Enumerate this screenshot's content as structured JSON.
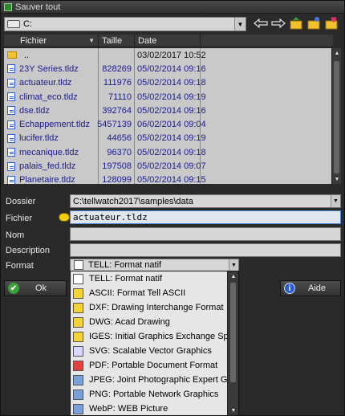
{
  "window": {
    "title": "Sauver tout"
  },
  "drive": {
    "label": "C:"
  },
  "list": {
    "headers": {
      "name": "Fichier",
      "size": "Taille",
      "date": "Date"
    },
    "rows": [
      {
        "name": "..",
        "size": "",
        "date": "03/02/2017 10:52",
        "type": "folder"
      },
      {
        "name": "23Y Series.tldz",
        "size": "828269",
        "date": "05/02/2014 09:16",
        "type": "file"
      },
      {
        "name": "actuateur.tldz",
        "size": "111976",
        "date": "05/02/2014 09:18",
        "type": "file"
      },
      {
        "name": "climat_eco.tldz",
        "size": "71110",
        "date": "05/02/2014 09:19",
        "type": "file"
      },
      {
        "name": "dse.tldz",
        "size": "392764",
        "date": "05/02/2014 09:16",
        "type": "file"
      },
      {
        "name": "Echappement.tldz",
        "size": "5457139",
        "date": "06/02/2014 09:04",
        "type": "file"
      },
      {
        "name": "lucifer.tldz",
        "size": "44656",
        "date": "05/02/2014 09:19",
        "type": "file"
      },
      {
        "name": "mecanique.tldz",
        "size": "96370",
        "date": "05/02/2014 09:18",
        "type": "file"
      },
      {
        "name": "palais_fed.tldz",
        "size": "197508",
        "date": "05/02/2014 09:07",
        "type": "file"
      },
      {
        "name": "Planetaire.tldz",
        "size": "128099",
        "date": "05/02/2014 09:15",
        "type": "file"
      }
    ]
  },
  "form": {
    "dossier_label": "Dossier",
    "dossier_value": "C:\\tellwatch2017\\samples\\data",
    "fichier_label": "Fichier",
    "fichier_value": "actuateur.tldz",
    "nom_label": "Nom",
    "nom_value": "",
    "description_label": "Description",
    "description_value": "",
    "format_label": "Format",
    "format_value": "TELL: Format natif"
  },
  "buttons": {
    "ok": "Ok",
    "aide": "Aide"
  },
  "format_options": [
    {
      "label": "TELL: Format natif",
      "icon": "tell-icon",
      "color": "#ffffff"
    },
    {
      "label": "ASCII: Format Tell ASCII",
      "icon": "ascii-icon",
      "color": "#f2d43a"
    },
    {
      "label": "DXF: Drawing Interchange Format",
      "icon": "dxf-icon",
      "color": "#f2d43a"
    },
    {
      "label": "DWG: Acad Drawing",
      "icon": "dwg-icon",
      "color": "#f2d43a"
    },
    {
      "label": "IGES: Initial Graphics Exchange Specifi",
      "icon": "iges-icon",
      "color": "#f2d43a"
    },
    {
      "label": "SVG: Scalable Vector Graphics",
      "icon": "svg-icon",
      "color": "#d8d8ff"
    },
    {
      "label": "PDF: Portable Document Format",
      "icon": "pdf-icon",
      "color": "#e04040"
    },
    {
      "label": "JPEG: Joint Photographic Expert Group",
      "icon": "jpeg-icon",
      "color": "#7aa0d8"
    },
    {
      "label": "PNG: Portable Network Graphics",
      "icon": "png-icon",
      "color": "#7aa0d8"
    },
    {
      "label": "WebP: WEB Picture",
      "icon": "webp-icon",
      "color": "#7aa0d8"
    }
  ]
}
